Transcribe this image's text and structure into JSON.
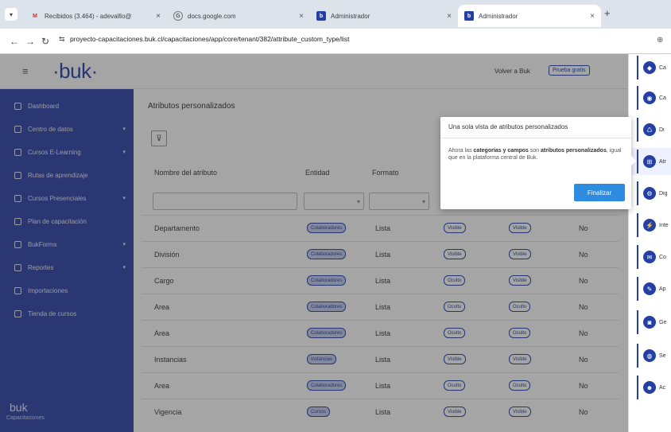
{
  "browser": {
    "tabs": [
      {
        "label": "Recibidos (3.464) - adevalllo@",
        "favicon": "M"
      },
      {
        "label": "docs.google.com",
        "favicon": "G"
      },
      {
        "label": "Administrador",
        "favicon": "b"
      },
      {
        "label": "Administrador",
        "favicon": "b"
      }
    ],
    "url": "proyecto-capacitaciones.buk.cl/capacitaciones/app/core/tenant/382/attribute_custom_type/list"
  },
  "header": {
    "logo": "·buk·",
    "volver": "Volver a Buk",
    "prueba": "Prueba gratis"
  },
  "sidebar": {
    "items": [
      {
        "label": "Dashboard",
        "chevron": false
      },
      {
        "label": "Centro de datos",
        "chevron": true
      },
      {
        "label": "Cursos E-Learning",
        "chevron": true
      },
      {
        "label": "Rutas de aprendizaje",
        "chevron": false
      },
      {
        "label": "Cursos Presenciales",
        "chevron": true
      },
      {
        "label": "Plan de capacitación",
        "chevron": false
      },
      {
        "label": "BukForms",
        "chevron": true
      },
      {
        "label": "Reportes",
        "chevron": true
      },
      {
        "label": "Importaciones",
        "chevron": false
      },
      {
        "label": "Tienda de cursos",
        "chevron": false
      }
    ],
    "footer_logo": "buk",
    "footer_sub": "Capacitaciones"
  },
  "main": {
    "title": "Atributos personalizados",
    "filter_icon": "filter-icon",
    "columns": [
      "Nombre del atributo",
      "Entidad",
      "Formato"
    ],
    "rows": [
      {
        "name": "Departamento",
        "entidad": "Colaboradores",
        "formato": "Lista",
        "c1": "Visible",
        "c2": "Visible",
        "c3": "No"
      },
      {
        "name": "División",
        "entidad": "Colaboradores",
        "formato": "Lista",
        "c1": "Visible",
        "c2": "Visible",
        "c3": "No"
      },
      {
        "name": "Cargo",
        "entidad": "Colaboradores",
        "formato": "Lista",
        "c1": "Oculto",
        "c2": "Visible",
        "c3": "No"
      },
      {
        "name": "Area",
        "entidad": "Colaboradores",
        "formato": "Lista",
        "c1": "Oculto",
        "c2": "Oculto",
        "c3": "No"
      },
      {
        "name": "Area",
        "entidad": "Colaboradores",
        "formato": "Lista",
        "c1": "Oculto",
        "c2": "Oculto",
        "c3": "No"
      },
      {
        "name": "Instancias",
        "entidad": "Instancias",
        "formato": "Lista",
        "c1": "Visible",
        "c2": "Visible",
        "c3": "No"
      },
      {
        "name": "Area",
        "entidad": "Colaboradores",
        "formato": "Lista",
        "c1": "Oculto",
        "c2": "Oculto",
        "c3": "No"
      },
      {
        "name": "Vigencia",
        "entidad": "Cursos",
        "formato": "Lista",
        "c1": "Visible",
        "c2": "Visible",
        "c3": "No"
      }
    ]
  },
  "right_panel": {
    "items": [
      {
        "label": "Ca",
        "icon": "tag-icon"
      },
      {
        "label": "Ca",
        "icon": "eye-icon"
      },
      {
        "label": "Di",
        "icon": "recycle-icon"
      },
      {
        "label": "Atr",
        "icon": "grid-icon",
        "selected": true
      },
      {
        "label": "Dig",
        "icon": "gear-icon"
      },
      {
        "label": "Inte",
        "icon": "plug-icon"
      },
      {
        "label": "Co",
        "icon": "mail-icon"
      },
      {
        "label": "Ap",
        "icon": "pencil-icon"
      },
      {
        "label": "Ge",
        "icon": "camera-icon"
      },
      {
        "label": "Se",
        "icon": "globe-icon"
      },
      {
        "label": "Ac",
        "icon": "user-icon"
      }
    ]
  },
  "popover": {
    "title": "Una sola vista de atributos personalizados",
    "body_1": "Ahora las ",
    "body_bold_1": "categorías y campos",
    "body_2": " son ",
    "body_bold_2": "atributos personalizados",
    "body_3": ", igual que en la plataforma central de Buk.",
    "button": "Finalizar"
  },
  "colors": {
    "brand": "#2540a4",
    "button": "#2d8be0"
  }
}
